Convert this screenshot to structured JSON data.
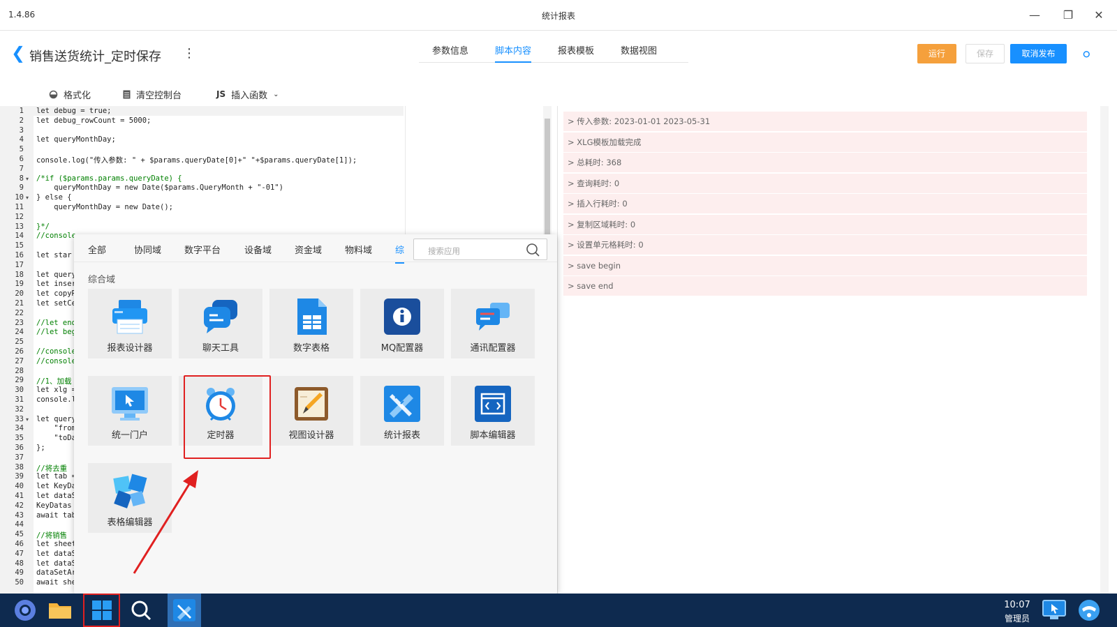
{
  "window": {
    "version": "1.4.86",
    "title": "统计报表"
  },
  "header": {
    "page_title": "销售送货统计_定时保存",
    "tabs": [
      {
        "label": "参数信息",
        "active": false
      },
      {
        "label": "脚本内容",
        "active": true
      },
      {
        "label": "报表模板",
        "active": false
      },
      {
        "label": "数据视图",
        "active": false
      }
    ],
    "buttons": {
      "run": "运行",
      "save": "保存",
      "unpublish": "取消发布"
    }
  },
  "toolbar": {
    "format": "格式化",
    "clear_console": "清空控制台",
    "js_badge": "JS",
    "insert_function": "插入函数"
  },
  "editor": {
    "line_numbers": [
      "1",
      "2",
      "3",
      "4",
      "5",
      "6",
      "7",
      "8",
      "9",
      "10",
      "11",
      "12",
      "13",
      "14",
      "15",
      "16",
      "17",
      "18",
      "19",
      "20",
      "21",
      "22",
      "23",
      "24",
      "25",
      "26",
      "27",
      "28",
      "29",
      "30",
      "31",
      "32",
      "33",
      "34",
      "35",
      "36",
      "37",
      "38",
      "39",
      "40",
      "41",
      "42",
      "43",
      "44",
      "45",
      "46",
      "47",
      "48",
      "49",
      "50"
    ],
    "lines": [
      "let debug = true;",
      "let debug_rowCount = 5000;",
      "",
      "let queryMonthDay;",
      "",
      "console.log(\"传入参数: \" + $params.queryDate[0]+\" \"+$params.queryDate[1]);",
      "",
      "/*if ($params.params.queryDate) {",
      "    queryMonthDay = new Date($params.QueryMonth + \"-01\")",
      "} else {",
      "    queryMonthDay = new Date();",
      "",
      "}*/",
      "//console",
      "",
      "let star",
      "",
      "let query",
      "let inser",
      "let copyR",
      "let setCe",
      "",
      "//let end",
      "//let beg",
      "",
      "//console",
      "//console",
      "",
      "//1、加载",
      "let xlg =",
      "console.l",
      "",
      "let query",
      "    \"fromD",
      "    \"toDat",
      "};",
      "",
      "//将去重",
      "let tab =",
      "let KeyDa",
      "let dataS",
      "KeyDatas",
      "await tab",
      "",
      "//将销售",
      "let sheet",
      "let dataS",
      "let dataS",
      "dataSetAr",
      "await she"
    ]
  },
  "console": {
    "logs": [
      "> 传入参数: 2023-01-01 2023-05-31",
      "> XLG模板加载完成",
      "> 总耗时: 368",
      "> 查询耗时: 0",
      "> 插入行耗时: 0",
      "> 复制区域耗时: 0",
      "> 设置单元格耗时: 0",
      "> save begin",
      "> save end"
    ]
  },
  "launcher": {
    "tabs": [
      {
        "label": "全部",
        "active": false
      },
      {
        "label": "协同域",
        "active": false
      },
      {
        "label": "数字平台",
        "active": false
      },
      {
        "label": "设备域",
        "active": false
      },
      {
        "label": "资金域",
        "active": false
      },
      {
        "label": "物料域",
        "active": false
      },
      {
        "label": "综",
        "active": true
      }
    ],
    "search_placeholder": "搜索应用",
    "section_title": "综合域",
    "apps": [
      {
        "label": "报表设计器",
        "icon": "printer-icon"
      },
      {
        "label": "聊天工具",
        "icon": "chat-bubble-icon"
      },
      {
        "label": "数字表格",
        "icon": "spreadsheet-icon"
      },
      {
        "label": "MQ配置器",
        "icon": "info-icon"
      },
      {
        "label": "通讯配置器",
        "icon": "message-icon"
      },
      {
        "label": "统一门户",
        "icon": "monitor-cursor-icon"
      },
      {
        "label": "定时器",
        "icon": "alarm-clock-icon"
      },
      {
        "label": "视图设计器",
        "icon": "pencil-paper-icon"
      },
      {
        "label": "统计报表",
        "icon": "ruler-pencil-icon"
      },
      {
        "label": "脚本编辑器",
        "icon": "code-window-icon"
      },
      {
        "label": "表格编辑器",
        "icon": "butterfly-icon"
      }
    ]
  },
  "taskbar": {
    "time": "10:07",
    "user": "管理员"
  },
  "colors": {
    "accent": "#1890ff",
    "run": "#f5a03c",
    "annotation": "#e02020",
    "taskbar": "#0e2a4f"
  }
}
